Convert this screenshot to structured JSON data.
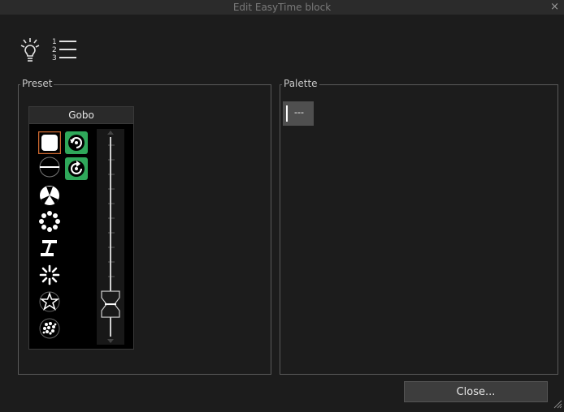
{
  "window": {
    "title": "Edit EasyTime block",
    "close_glyph": "×"
  },
  "toolbar": {
    "icons": [
      "lightbulb-icon",
      "numbered-list-icon"
    ]
  },
  "preset": {
    "legend": "Preset",
    "panel_title": "Gobo",
    "gobos": [
      "open",
      "rotate-cw",
      "line",
      "rotate-ccw",
      "fan",
      "dot-ring",
      "i-beam",
      "burst",
      "star",
      "dots-cluster"
    ],
    "fader_level": 0.12
  },
  "palette": {
    "legend": "Palette",
    "item_label": "---"
  },
  "footer": {
    "close_label": "Close..."
  },
  "colors": {
    "accent_green": "#2fa85a",
    "selected_orange": "#d06a30",
    "background": "#1c1c1c"
  }
}
